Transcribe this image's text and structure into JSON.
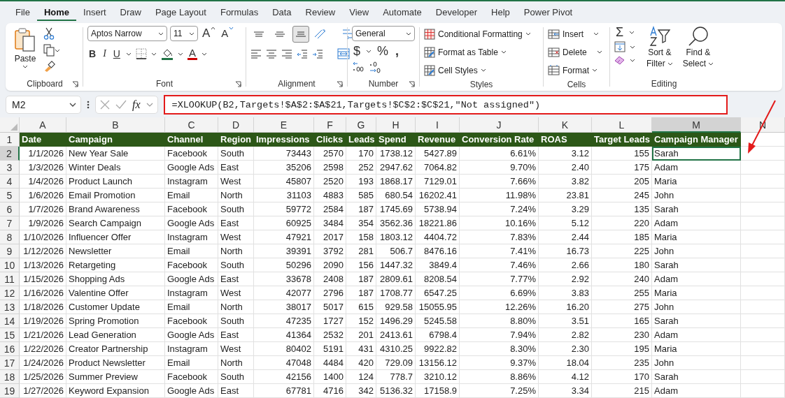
{
  "menu_tabs": [
    {
      "label": "File",
      "selected": false
    },
    {
      "label": "Home",
      "selected": true
    },
    {
      "label": "Insert",
      "selected": false
    },
    {
      "label": "Draw",
      "selected": false
    },
    {
      "label": "Page Layout",
      "selected": false
    },
    {
      "label": "Formulas",
      "selected": false
    },
    {
      "label": "Data",
      "selected": false
    },
    {
      "label": "Review",
      "selected": false
    },
    {
      "label": "View",
      "selected": false
    },
    {
      "label": "Automate",
      "selected": false
    },
    {
      "label": "Developer",
      "selected": false
    },
    {
      "label": "Help",
      "selected": false
    },
    {
      "label": "Power Pivot",
      "selected": false
    }
  ],
  "ribbon": {
    "clipboard": {
      "paste": "Paste",
      "label": "Clipboard"
    },
    "font": {
      "name": "Aptos Narrow",
      "size": "11",
      "grow": "A",
      "shrink": "A",
      "bold": "B",
      "italic": "I",
      "underline": "U",
      "color_letter": "A",
      "label": "Font"
    },
    "alignment": {
      "buttons": [
        {
          "kind": "top",
          "selected": false
        },
        {
          "kind": "middle",
          "selected": false
        },
        {
          "kind": "bottom",
          "selected": true
        }
      ],
      "label": "Alignment"
    },
    "number": {
      "format": "General",
      "currency": "$",
      "percent": "%",
      "comma": ",",
      "label": "Number"
    },
    "styles": {
      "items": [
        "Conditional Formatting",
        "Format as Table",
        "Cell Styles"
      ],
      "label": "Styles"
    },
    "cells": {
      "items": [
        "Insert",
        "Delete",
        "Format"
      ],
      "label": "Cells"
    },
    "editing": {
      "autosum": "Σ",
      "sort": [
        "Sort &",
        "Filter"
      ],
      "find": [
        "Find &",
        "Select"
      ],
      "label": "Editing"
    }
  },
  "formula_bar": {
    "name_box": "M2",
    "fx": "fx",
    "formula": "=XLOOKUP(B2,Targets!$A$2:$A$21,Targets!$C$2:$C$21,\"Not assigned\")",
    "highlighted": true
  },
  "annotation": {
    "arrow_to_active_cell": true
  },
  "sheet": {
    "columns": [
      {
        "letter": "A",
        "kind": "number",
        "selected": false
      },
      {
        "letter": "B",
        "kind": "text",
        "selected": false
      },
      {
        "letter": "C",
        "kind": "text",
        "selected": false
      },
      {
        "letter": "D",
        "kind": "text",
        "selected": false
      },
      {
        "letter": "E",
        "kind": "number",
        "selected": false
      },
      {
        "letter": "F",
        "kind": "number",
        "selected": false
      },
      {
        "letter": "G",
        "kind": "number",
        "selected": false
      },
      {
        "letter": "H",
        "kind": "number",
        "selected": false
      },
      {
        "letter": "I",
        "kind": "number",
        "selected": false
      },
      {
        "letter": "J",
        "kind": "number",
        "selected": false
      },
      {
        "letter": "K",
        "kind": "number",
        "selected": false
      },
      {
        "letter": "L",
        "kind": "number",
        "selected": false
      },
      {
        "letter": "M",
        "kind": "text",
        "selected": true
      },
      {
        "letter": "N",
        "selected": false
      }
    ],
    "header_row": {
      "number": "1",
      "cells": [
        "Date",
        "Campaign",
        "Channel",
        "Region",
        "Impressions",
        "Clicks",
        "Leads",
        "Spend",
        "Revenue",
        "Conversion Rate",
        "ROAS",
        "Target Leads",
        "Campaign Manager"
      ]
    },
    "rows": [
      {
        "number": "2",
        "selected": true,
        "cells": [
          "1/1/2026",
          "New Year Sale",
          "Facebook",
          "South",
          "73443",
          "2570",
          "170",
          "1738.12",
          "5427.89",
          "6.61%",
          "3.12",
          "155",
          "Sarah"
        ]
      },
      {
        "number": "3",
        "selected": false,
        "cells": [
          "1/3/2026",
          "Winter Deals",
          "Google Ads",
          "East",
          "35206",
          "2598",
          "252",
          "2947.62",
          "7064.82",
          "9.70%",
          "2.40",
          "175",
          "Adam"
        ]
      },
      {
        "number": "4",
        "selected": false,
        "cells": [
          "1/4/2026",
          "Product Launch",
          "Instagram",
          "West",
          "45807",
          "2520",
          "193",
          "1868.17",
          "7129.01",
          "7.66%",
          "3.82",
          "205",
          "Maria"
        ]
      },
      {
        "number": "5",
        "selected": false,
        "cells": [
          "1/6/2026",
          "Email Promotion",
          "Email",
          "North",
          "31103",
          "4883",
          "585",
          "680.54",
          "16202.41",
          "11.98%",
          "23.81",
          "245",
          "John"
        ]
      },
      {
        "number": "6",
        "selected": false,
        "cells": [
          "1/7/2026",
          "Brand Awareness",
          "Facebook",
          "South",
          "59772",
          "2584",
          "187",
          "1745.69",
          "5738.94",
          "7.24%",
          "3.29",
          "135",
          "Sarah"
        ]
      },
      {
        "number": "7",
        "selected": false,
        "cells": [
          "1/9/2026",
          "Search Campaign",
          "Google Ads",
          "East",
          "60925",
          "3484",
          "354",
          "3562.36",
          "18221.86",
          "10.16%",
          "5.12",
          "220",
          "Adam"
        ]
      },
      {
        "number": "8",
        "selected": false,
        "cells": [
          "1/10/2026",
          "Influencer Offer",
          "Instagram",
          "West",
          "47921",
          "2017",
          "158",
          "1803.12",
          "4404.72",
          "7.83%",
          "2.44",
          "185",
          "Maria"
        ]
      },
      {
        "number": "9",
        "selected": false,
        "cells": [
          "1/12/2026",
          "Newsletter",
          "Email",
          "North",
          "39391",
          "3792",
          "281",
          "506.7",
          "8476.16",
          "7.41%",
          "16.73",
          "225",
          "John"
        ]
      },
      {
        "number": "10",
        "selected": false,
        "cells": [
          "1/13/2026",
          "Retargeting",
          "Facebook",
          "South",
          "50296",
          "2090",
          "156",
          "1447.32",
          "3849.4",
          "7.46%",
          "2.66",
          "180",
          "Sarah"
        ]
      },
      {
        "number": "11",
        "selected": false,
        "cells": [
          "1/15/2026",
          "Shopping Ads",
          "Google Ads",
          "East",
          "33678",
          "2408",
          "187",
          "2809.61",
          "8208.54",
          "7.77%",
          "2.92",
          "240",
          "Adam"
        ]
      },
      {
        "number": "12",
        "selected": false,
        "cells": [
          "1/16/2026",
          "Valentine Offer",
          "Instagram",
          "West",
          "42077",
          "2796",
          "187",
          "1708.77",
          "6547.25",
          "6.69%",
          "3.83",
          "255",
          "Maria"
        ]
      },
      {
        "number": "13",
        "selected": false,
        "cells": [
          "1/18/2026",
          "Customer Update",
          "Email",
          "North",
          "38017",
          "5017",
          "615",
          "929.58",
          "15055.95",
          "12.26%",
          "16.20",
          "275",
          "John"
        ]
      },
      {
        "number": "14",
        "selected": false,
        "cells": [
          "1/19/2026",
          "Spring Promotion",
          "Facebook",
          "South",
          "47235",
          "1727",
          "152",
          "1496.29",
          "5245.58",
          "8.80%",
          "3.51",
          "165",
          "Sarah"
        ]
      },
      {
        "number": "15",
        "selected": false,
        "cells": [
          "1/21/2026",
          "Lead Generation",
          "Google Ads",
          "East",
          "41364",
          "2532",
          "201",
          "2413.61",
          "6798.4",
          "7.94%",
          "2.82",
          "230",
          "Adam"
        ]
      },
      {
        "number": "16",
        "selected": false,
        "cells": [
          "1/22/2026",
          "Creator Partnership",
          "Instagram",
          "West",
          "80402",
          "5191",
          "431",
          "4310.25",
          "9922.82",
          "8.30%",
          "2.30",
          "195",
          "Maria"
        ]
      },
      {
        "number": "17",
        "selected": false,
        "cells": [
          "1/24/2026",
          "Product Newsletter",
          "Email",
          "North",
          "47048",
          "4484",
          "420",
          "729.09",
          "13156.12",
          "9.37%",
          "18.04",
          "235",
          "John"
        ]
      },
      {
        "number": "18",
        "selected": false,
        "cells": [
          "1/25/2026",
          "Summer Preview",
          "Facebook",
          "South",
          "42156",
          "1400",
          "124",
          "778.7",
          "3210.12",
          "8.86%",
          "4.12",
          "170",
          "Sarah"
        ]
      },
      {
        "number": "19",
        "selected": false,
        "cells": [
          "1/27/2026",
          "Keyword Expansion",
          "Google Ads",
          "East",
          "67781",
          "4716",
          "342",
          "5136.32",
          "17158.9",
          "7.25%",
          "3.34",
          "215",
          "Adam"
        ]
      }
    ]
  }
}
